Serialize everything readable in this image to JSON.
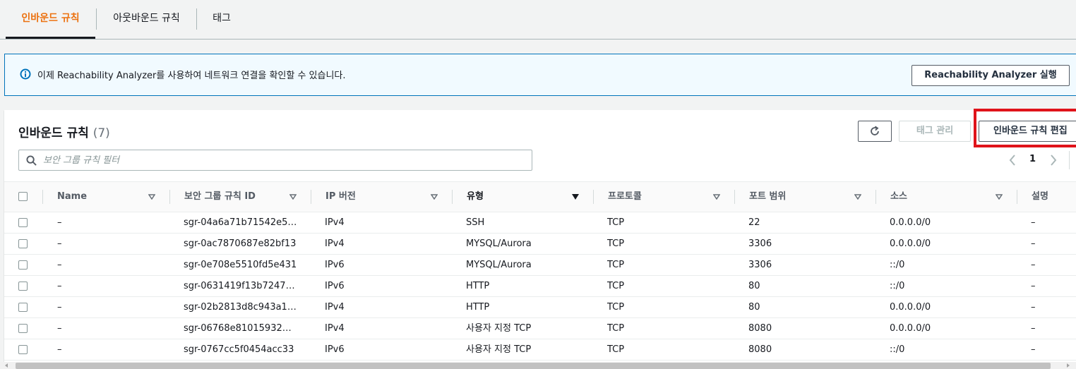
{
  "tabs": [
    {
      "label": "인바운드 규칙",
      "active": true
    },
    {
      "label": "아웃바운드 규칙",
      "active": false
    },
    {
      "label": "태그",
      "active": false
    }
  ],
  "banner": {
    "icon": "info-icon",
    "text": "이제 Reachability Analyzer를 사용하여 네트워크 연결을 확인할 수 있습니다.",
    "button_label": "Reachability Analyzer 실행"
  },
  "panel": {
    "title": "인바운드 규칙",
    "count": "(7)",
    "refresh_icon": "refresh-icon",
    "manage_tags_label": "태그 관리",
    "edit_rules_label": "인바운드 규칙 편집",
    "search_placeholder": "보안 그룹 규칙 필터",
    "page": "1"
  },
  "table": {
    "columns": [
      "Name",
      "보안 그룹 규칙 ID",
      "IP 버전",
      "유형",
      "프로토콜",
      "포트 범위",
      "소스",
      "설명"
    ],
    "rows": [
      {
        "name": "–",
        "id": "sgr-04a6a71b71542e5…",
        "ip": "IPv4",
        "type": "SSH",
        "proto": "TCP",
        "port": "22",
        "source": "0.0.0.0/0",
        "desc": "–"
      },
      {
        "name": "–",
        "id": "sgr-0ac7870687e82bf13",
        "ip": "IPv4",
        "type": "MYSQL/Aurora",
        "proto": "TCP",
        "port": "3306",
        "source": "0.0.0.0/0",
        "desc": "–"
      },
      {
        "name": "–",
        "id": "sgr-0e708e5510fd5e431",
        "ip": "IPv6",
        "type": "MYSQL/Aurora",
        "proto": "TCP",
        "port": "3306",
        "source": "::/0",
        "desc": "–"
      },
      {
        "name": "–",
        "id": "sgr-0631419f13b7247…",
        "ip": "IPv6",
        "type": "HTTP",
        "proto": "TCP",
        "port": "80",
        "source": "::/0",
        "desc": "–"
      },
      {
        "name": "–",
        "id": "sgr-02b2813d8c943a1…",
        "ip": "IPv4",
        "type": "HTTP",
        "proto": "TCP",
        "port": "80",
        "source": "0.0.0.0/0",
        "desc": "–"
      },
      {
        "name": "–",
        "id": "sgr-06768e81015932…",
        "ip": "IPv4",
        "type": "사용자 지정 TCP",
        "proto": "TCP",
        "port": "8080",
        "source": "0.0.0.0/0",
        "desc": "–"
      },
      {
        "name": "–",
        "id": "sgr-0767cc5f0454acc33",
        "ip": "IPv6",
        "type": "사용자 지정 TCP",
        "proto": "TCP",
        "port": "8080",
        "source": "::/0",
        "desc": "–"
      }
    ]
  },
  "colors": {
    "accent_orange": "#ec7211",
    "info_blue": "#0073bb",
    "highlight_red": "#e0131a"
  }
}
